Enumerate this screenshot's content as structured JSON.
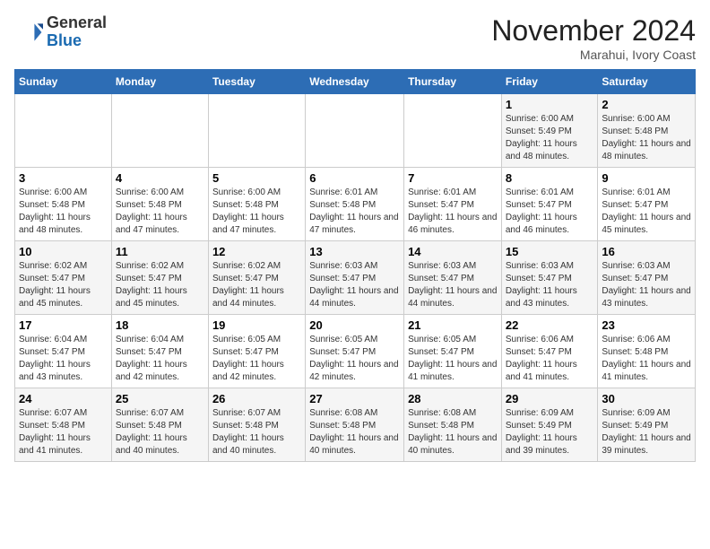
{
  "header": {
    "logo_general": "General",
    "logo_blue": "Blue",
    "month_title": "November 2024",
    "location": "Marahui, Ivory Coast"
  },
  "days_of_week": [
    "Sunday",
    "Monday",
    "Tuesday",
    "Wednesday",
    "Thursday",
    "Friday",
    "Saturday"
  ],
  "weeks": [
    [
      {
        "day": "",
        "info": ""
      },
      {
        "day": "",
        "info": ""
      },
      {
        "day": "",
        "info": ""
      },
      {
        "day": "",
        "info": ""
      },
      {
        "day": "",
        "info": ""
      },
      {
        "day": "1",
        "info": "Sunrise: 6:00 AM\nSunset: 5:49 PM\nDaylight: 11 hours and 48 minutes."
      },
      {
        "day": "2",
        "info": "Sunrise: 6:00 AM\nSunset: 5:48 PM\nDaylight: 11 hours and 48 minutes."
      }
    ],
    [
      {
        "day": "3",
        "info": "Sunrise: 6:00 AM\nSunset: 5:48 PM\nDaylight: 11 hours and 48 minutes."
      },
      {
        "day": "4",
        "info": "Sunrise: 6:00 AM\nSunset: 5:48 PM\nDaylight: 11 hours and 47 minutes."
      },
      {
        "day": "5",
        "info": "Sunrise: 6:00 AM\nSunset: 5:48 PM\nDaylight: 11 hours and 47 minutes."
      },
      {
        "day": "6",
        "info": "Sunrise: 6:01 AM\nSunset: 5:48 PM\nDaylight: 11 hours and 47 minutes."
      },
      {
        "day": "7",
        "info": "Sunrise: 6:01 AM\nSunset: 5:47 PM\nDaylight: 11 hours and 46 minutes."
      },
      {
        "day": "8",
        "info": "Sunrise: 6:01 AM\nSunset: 5:47 PM\nDaylight: 11 hours and 46 minutes."
      },
      {
        "day": "9",
        "info": "Sunrise: 6:01 AM\nSunset: 5:47 PM\nDaylight: 11 hours and 45 minutes."
      }
    ],
    [
      {
        "day": "10",
        "info": "Sunrise: 6:02 AM\nSunset: 5:47 PM\nDaylight: 11 hours and 45 minutes."
      },
      {
        "day": "11",
        "info": "Sunrise: 6:02 AM\nSunset: 5:47 PM\nDaylight: 11 hours and 45 minutes."
      },
      {
        "day": "12",
        "info": "Sunrise: 6:02 AM\nSunset: 5:47 PM\nDaylight: 11 hours and 44 minutes."
      },
      {
        "day": "13",
        "info": "Sunrise: 6:03 AM\nSunset: 5:47 PM\nDaylight: 11 hours and 44 minutes."
      },
      {
        "day": "14",
        "info": "Sunrise: 6:03 AM\nSunset: 5:47 PM\nDaylight: 11 hours and 44 minutes."
      },
      {
        "day": "15",
        "info": "Sunrise: 6:03 AM\nSunset: 5:47 PM\nDaylight: 11 hours and 43 minutes."
      },
      {
        "day": "16",
        "info": "Sunrise: 6:03 AM\nSunset: 5:47 PM\nDaylight: 11 hours and 43 minutes."
      }
    ],
    [
      {
        "day": "17",
        "info": "Sunrise: 6:04 AM\nSunset: 5:47 PM\nDaylight: 11 hours and 43 minutes."
      },
      {
        "day": "18",
        "info": "Sunrise: 6:04 AM\nSunset: 5:47 PM\nDaylight: 11 hours and 42 minutes."
      },
      {
        "day": "19",
        "info": "Sunrise: 6:05 AM\nSunset: 5:47 PM\nDaylight: 11 hours and 42 minutes."
      },
      {
        "day": "20",
        "info": "Sunrise: 6:05 AM\nSunset: 5:47 PM\nDaylight: 11 hours and 42 minutes."
      },
      {
        "day": "21",
        "info": "Sunrise: 6:05 AM\nSunset: 5:47 PM\nDaylight: 11 hours and 41 minutes."
      },
      {
        "day": "22",
        "info": "Sunrise: 6:06 AM\nSunset: 5:47 PM\nDaylight: 11 hours and 41 minutes."
      },
      {
        "day": "23",
        "info": "Sunrise: 6:06 AM\nSunset: 5:48 PM\nDaylight: 11 hours and 41 minutes."
      }
    ],
    [
      {
        "day": "24",
        "info": "Sunrise: 6:07 AM\nSunset: 5:48 PM\nDaylight: 11 hours and 41 minutes."
      },
      {
        "day": "25",
        "info": "Sunrise: 6:07 AM\nSunset: 5:48 PM\nDaylight: 11 hours and 40 minutes."
      },
      {
        "day": "26",
        "info": "Sunrise: 6:07 AM\nSunset: 5:48 PM\nDaylight: 11 hours and 40 minutes."
      },
      {
        "day": "27",
        "info": "Sunrise: 6:08 AM\nSunset: 5:48 PM\nDaylight: 11 hours and 40 minutes."
      },
      {
        "day": "28",
        "info": "Sunrise: 6:08 AM\nSunset: 5:48 PM\nDaylight: 11 hours and 40 minutes."
      },
      {
        "day": "29",
        "info": "Sunrise: 6:09 AM\nSunset: 5:49 PM\nDaylight: 11 hours and 39 minutes."
      },
      {
        "day": "30",
        "info": "Sunrise: 6:09 AM\nSunset: 5:49 PM\nDaylight: 11 hours and 39 minutes."
      }
    ]
  ]
}
